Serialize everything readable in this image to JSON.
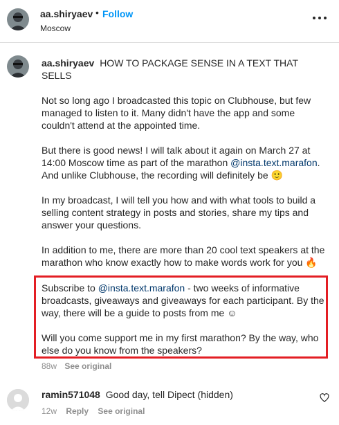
{
  "post_header": {
    "username": "aa.shiryaev",
    "separator": "•",
    "follow_label": "Follow",
    "location": "Moscow"
  },
  "caption": {
    "username": "aa.shiryaev",
    "title": "HOW TO PACKAGE SENSE IN A TEXT THAT SELLS",
    "p1": "Not so long ago I broadcasted this topic on Clubhouse, but few managed to listen to it. Many didn't have the app and some couldn't attend at the appointed time.",
    "p2_before": "But there is good news! I will talk about it again on March 27 at 14:00 Moscow time as part of the marathon ",
    "p2_mention": "@insta.text.marafon",
    "p2_after": ". And unlike Clubhouse, the recording will definitely be",
    "p2_emoji": "🙂",
    "p3": "In my broadcast, I will tell you how and with what tools to build a selling content strategy in posts and stories, share my tips and answer your questions.",
    "p4": "In addition to me, there are more than 20 cool text speakers at the marathon who know exactly how to make words work for you",
    "p4_emoji": "🔥",
    "p5_before": "Subscribe to ",
    "p5_mention": "@insta.text.marafon",
    "p5_after": " - two weeks of informative broadcasts, giveaways and giveaways for each participant. By the way, there will be a guide to posts from me ☺",
    "p6": "Will you come support me in my first marathon? By the way, who else do you know from the speakers?"
  },
  "caption_meta": {
    "age": "88w",
    "see_original": "See original"
  },
  "comment": {
    "username": "ramin571048",
    "text": "Good day, tell Dipect (hidden)",
    "age": "12w",
    "reply_label": "Reply",
    "see_original": "See original"
  },
  "colors": {
    "link_blue": "#0095f6",
    "mention": "#00376b",
    "highlight_border": "#e31e24",
    "muted": "#8e8e8e"
  },
  "icons": {
    "more": "more-horizontal-icon",
    "heart": "heart-outline-icon"
  }
}
